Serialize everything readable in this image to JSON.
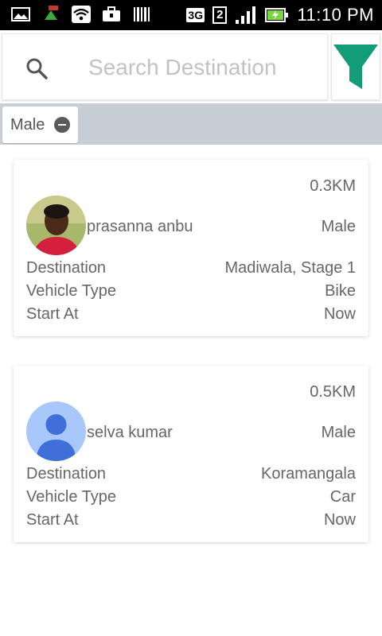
{
  "status_bar": {
    "network": "3G",
    "sim": "2",
    "time": "11:10 PM",
    "icons": [
      "gallery-icon",
      "app-notification-icon",
      "wifi-icon",
      "briefcase-icon",
      "barcode-icon",
      "signal-icon",
      "battery-charging-icon"
    ]
  },
  "search": {
    "placeholder": "Search Destination",
    "value": ""
  },
  "filter": {
    "icon": "filter-icon",
    "color": "#139c7a"
  },
  "chips": [
    {
      "label": "Male"
    }
  ],
  "riders": [
    {
      "distance": "0.3KM",
      "name": "prasanna anbu",
      "gender": "Male",
      "rows": [
        {
          "label": "Destination",
          "value": "Madiwala, Stage 1"
        },
        {
          "label": "Vehicle Type",
          "value": "Bike"
        },
        {
          "label": "Start At",
          "value": "Now"
        }
      ]
    },
    {
      "distance": "0.5KM",
      "name": "selva kumar",
      "gender": "Male",
      "rows": [
        {
          "label": "Destination",
          "value": "Koramangala"
        },
        {
          "label": "Vehicle Type",
          "value": "Car"
        },
        {
          "label": "Start At",
          "value": "Now"
        }
      ]
    }
  ]
}
